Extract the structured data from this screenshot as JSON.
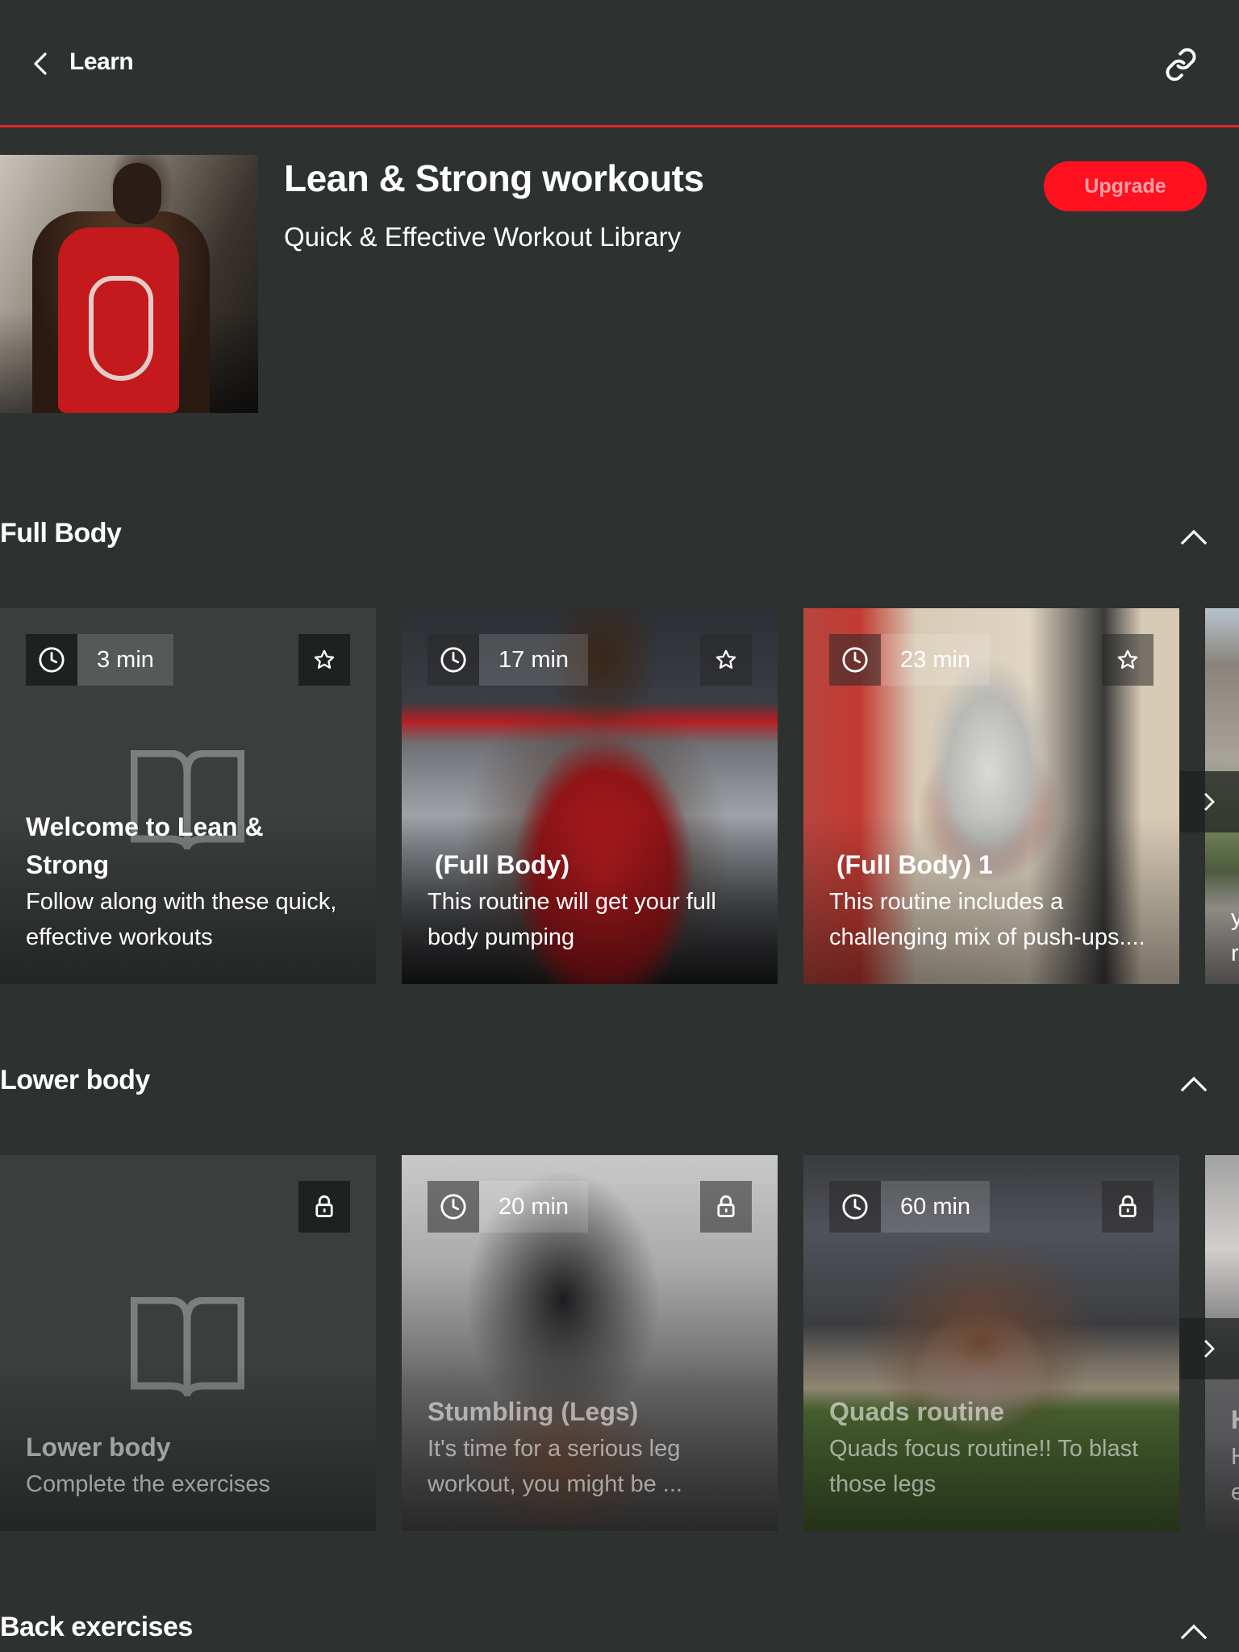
{
  "header": {
    "back_label": "Learn",
    "back_icon": "chevron-left-icon",
    "share_icon": "link-icon",
    "accent_color": "#e3262b"
  },
  "hero": {
    "title": "Lean & Strong workouts",
    "subtitle": "Quick & Effective Workout Library",
    "upgrade_label": "Upgrade",
    "upgrade_color": "#ff1120"
  },
  "sections": [
    {
      "title": "Full Body",
      "collapse_icon": "chevron-up-icon",
      "cards": [
        {
          "type": "placeholder",
          "time": "3 min",
          "title": "Welcome to Lean & Strong",
          "description": "Follow along with these quick, effective workouts",
          "action_icon": "star-icon",
          "locked": false
        },
        {
          "type": "photo",
          "time": "17 min",
          "title": " (Full Body)",
          "description": "This routine will get your full body pumping",
          "action_icon": "star-icon",
          "locked": false
        },
        {
          "type": "photo",
          "time": "23 min",
          "title": " (Full Body) 1",
          "description": "This routine includes a challenging mix of push-ups....",
          "action_icon": "star-icon",
          "locked": false
        },
        {
          "type": "photo",
          "partial": true,
          "text_line_1": "y",
          "text_line_2": "r"
        }
      ]
    },
    {
      "title": "Lower body",
      "collapse_icon": "chevron-up-icon",
      "cards": [
        {
          "type": "placeholder",
          "title": "Lower body",
          "description": "Complete the exercises",
          "action_icon": "lock-icon",
          "locked": true
        },
        {
          "type": "photo",
          "time": "20 min",
          "title": "Stumbling (Legs)",
          "description": "It's time for a serious leg workout, you might be ...",
          "action_icon": "lock-icon",
          "locked": true
        },
        {
          "type": "photo",
          "time": "60 min",
          "title": "Quads routine",
          "description": "Quads focus routine!! To blast those legs",
          "action_icon": "lock-icon",
          "locked": true
        },
        {
          "type": "photo",
          "partial": true,
          "title_fragment": "H",
          "text_line_1": "H",
          "text_line_2": "e"
        }
      ]
    },
    {
      "title": "Back exercises",
      "collapse_icon": "chevron-up-icon"
    }
  ]
}
